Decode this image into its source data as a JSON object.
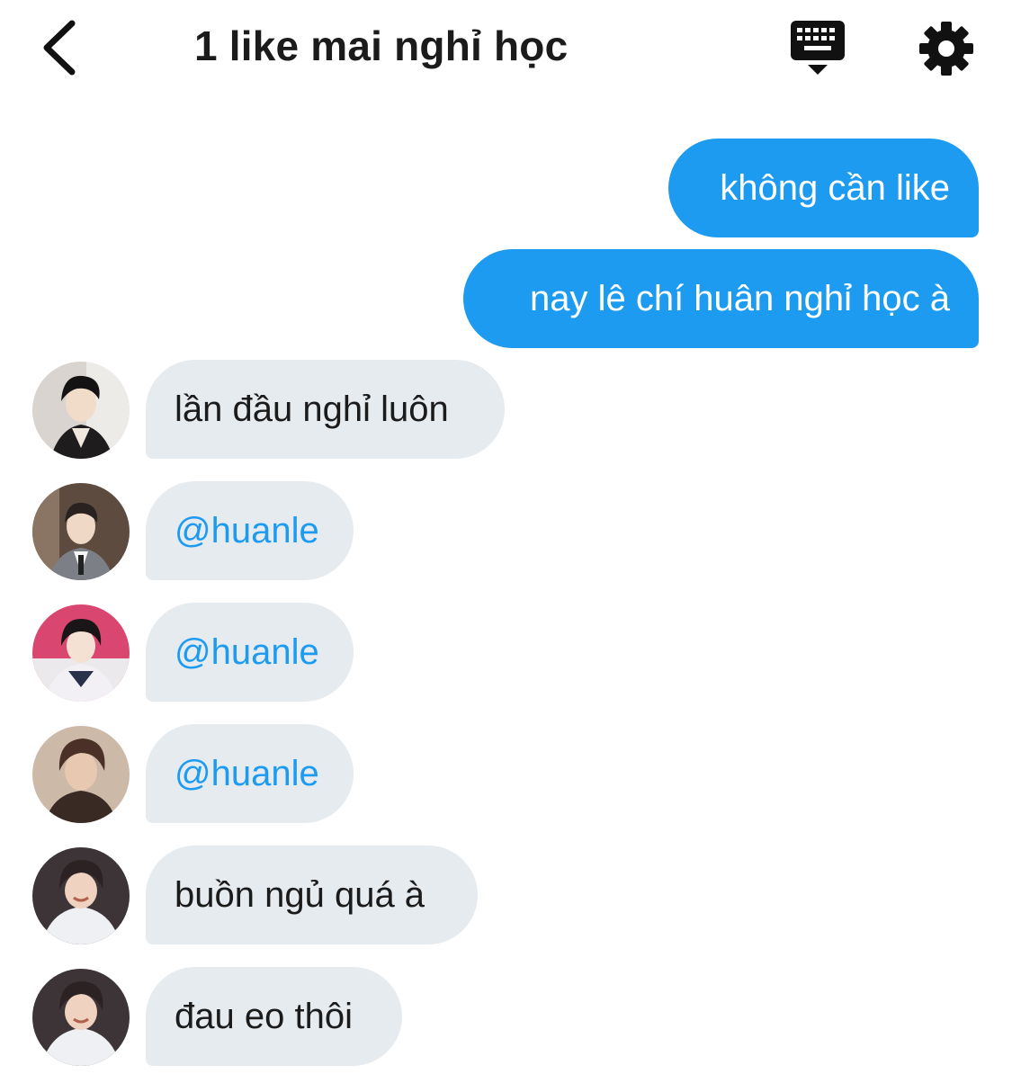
{
  "header": {
    "title": "1 like mai nghỉ học",
    "back_icon": "chevron-left-icon",
    "keyboard_icon": "keyboard-icon",
    "settings_icon": "gear-icon"
  },
  "colors": {
    "accent": "#1d9bf0",
    "incoming_bubble": "#e6ebef",
    "text": "#1b1b1b"
  },
  "outgoing_messages": [
    {
      "text": "không cần like"
    },
    {
      "text": "nay lê chí huân nghỉ học à"
    }
  ],
  "incoming_messages": [
    {
      "text": "lần đầu nghỉ luôn"
    },
    {
      "text": "@huanle"
    },
    {
      "text": "@huanle"
    },
    {
      "text": "@huanle"
    },
    {
      "text": "buồn ngủ quá à"
    },
    {
      "text": "đau eo thôi"
    }
  ]
}
